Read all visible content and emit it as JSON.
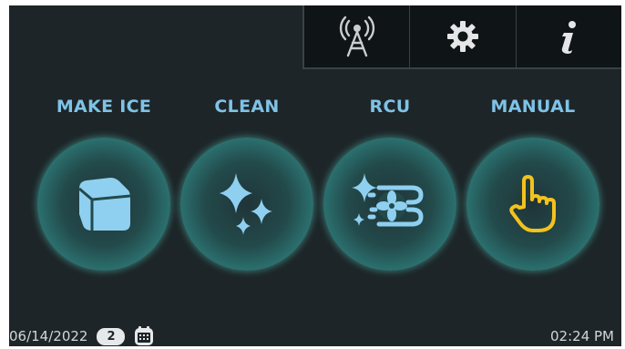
{
  "topbar": {
    "buttons": [
      {
        "icon": "antenna-signal-icon"
      },
      {
        "icon": "gear-icon"
      },
      {
        "icon": "info-icon"
      }
    ]
  },
  "modes": [
    {
      "label": "MAKE ICE",
      "icon": "ice-cube-icon"
    },
    {
      "label": "CLEAN",
      "icon": "sparkle-icon"
    },
    {
      "label": "RCU",
      "icon": "remote-condenser-fan-icon"
    },
    {
      "label": "MANUAL",
      "icon": "hand-pointer-icon"
    }
  ],
  "status": {
    "date": "06/14/2022",
    "badge": "2",
    "calendar_icon": "calendar-icon",
    "time": "02:24 PM"
  },
  "colors": {
    "background": "#1d2528",
    "label": "#7ec3e6",
    "icon_blue": "#8fd0f0",
    "icon_yellow": "#f3c21c",
    "ring_glow": "#5dd6c9"
  }
}
